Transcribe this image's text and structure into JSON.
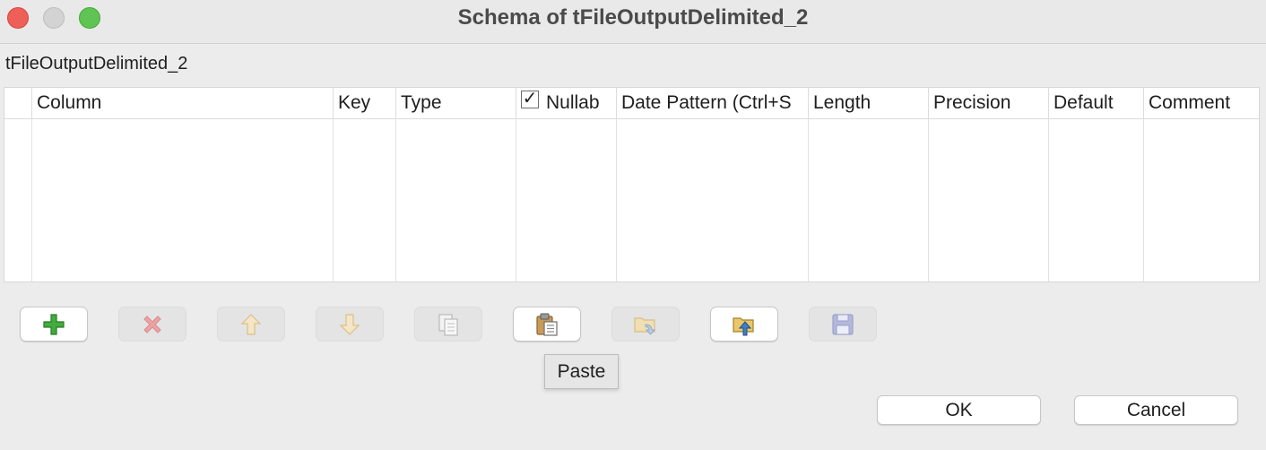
{
  "window": {
    "title": "Schema of tFileOutputDelimited_2",
    "controls": {
      "close": "close",
      "minimize": "minimize",
      "zoom": "zoom"
    }
  },
  "component_name": "tFileOutputDelimited_2",
  "table": {
    "columns": [
      {
        "label": ""
      },
      {
        "label": "Column"
      },
      {
        "label": "Key"
      },
      {
        "label": "Type"
      },
      {
        "label": "Nullab",
        "checkbox": "✓"
      },
      {
        "label": "Date Pattern (Ctrl+S"
      },
      {
        "label": "Length"
      },
      {
        "label": "Precision"
      },
      {
        "label": "Default"
      },
      {
        "label": "Comment"
      }
    ],
    "rows": []
  },
  "toolbar": {
    "buttons": [
      {
        "name": "add-button",
        "icon": "plus-icon",
        "enabled": true
      },
      {
        "name": "remove-button",
        "icon": "delete-x-icon",
        "enabled": false
      },
      {
        "name": "move-up-button",
        "icon": "arrow-up-icon",
        "enabled": false
      },
      {
        "name": "move-down-button",
        "icon": "arrow-down-icon",
        "enabled": false
      },
      {
        "name": "copy-button",
        "icon": "copy-icon",
        "enabled": false
      },
      {
        "name": "paste-button",
        "icon": "paste-icon",
        "enabled": true
      },
      {
        "name": "import-button",
        "icon": "folder-import-icon",
        "enabled": false
      },
      {
        "name": "export-button",
        "icon": "folder-export-icon",
        "enabled": true
      },
      {
        "name": "save-button",
        "icon": "floppy-disk-icon",
        "enabled": false
      }
    ],
    "tooltip": "Paste"
  },
  "actions": {
    "ok_label": "OK",
    "cancel_label": "Cancel"
  },
  "colors": {
    "background": "#ececec",
    "close": "#ee5f58",
    "zoom": "#5fc453",
    "plus_green": "#3aa63a",
    "delete_red": "#e46b6b"
  }
}
